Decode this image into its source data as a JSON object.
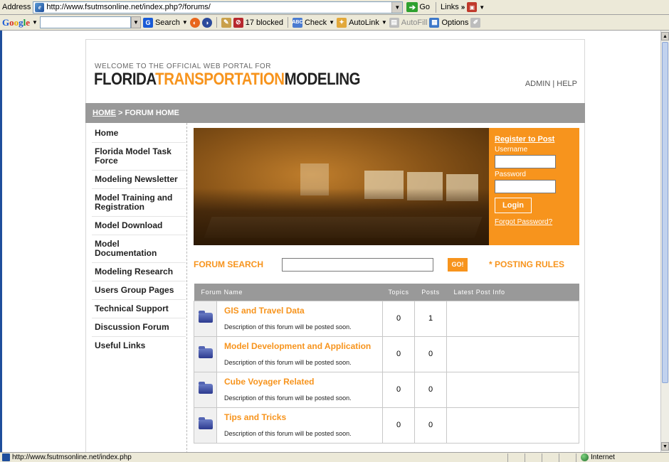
{
  "browser": {
    "address_label": "Address",
    "url": "http://www.fsutmsonline.net/index.php?/forums/",
    "go_label": "Go",
    "links_label": "Links",
    "links_chevron": "»",
    "toolbar": {
      "google_logo": [
        "G",
        "o",
        "o",
        "g",
        "l",
        "e"
      ],
      "search_label": "Search",
      "blocked_label": "17 blocked",
      "check_label": "Check",
      "autolink_label": "AutoLink",
      "autofill_label": "AutoFill",
      "options_label": "Options"
    },
    "status_url": "http://www.fsutmsonline.net/index.php",
    "zone_label": "Internet"
  },
  "header": {
    "welcome": "WELCOME TO THE OFFICIAL WEB PORTAL FOR",
    "brand_part1": "FLORIDA",
    "brand_part2": "TRANSPORTATION",
    "brand_part3": "MODELING",
    "admin_help": "ADMIN | HELP"
  },
  "breadcrumb": {
    "home": "HOME",
    "separator": ">",
    "current": "FORUM HOME"
  },
  "sidebar": {
    "items": [
      "Home",
      "Florida Model Task Force",
      "Modeling Newsletter",
      "Model Training and Registration",
      "Model Download",
      "Model Documentation",
      "Modeling Research",
      "Users Group Pages",
      "Technical Support",
      "Discussion Forum",
      "Useful Links"
    ]
  },
  "login": {
    "register": "Register to Post",
    "username_label": "Username",
    "password_label": "Password",
    "login_button": "Login",
    "forgot": "Forgot Password?"
  },
  "search": {
    "label": "FORUM SEARCH",
    "go": "GO!",
    "rules": "* POSTING RULES"
  },
  "forum_table": {
    "columns": [
      "Forum Name",
      "Topics",
      "Posts",
      "Latest Post Info"
    ],
    "rows": [
      {
        "name": "GIS and Travel Data",
        "description": "Description of this forum will be posted soon.",
        "topics": "0",
        "posts": "1"
      },
      {
        "name": "Model Development and Application",
        "description": "Description of this forum will be posted soon.",
        "topics": "0",
        "posts": "0"
      },
      {
        "name": "Cube Voyager Related",
        "description": "Description of this forum will be posted soon.",
        "topics": "0",
        "posts": "0"
      },
      {
        "name": "Tips and Tricks",
        "description": "Description of this forum will be posted soon.",
        "topics": "0",
        "posts": "0"
      }
    ]
  },
  "colors": {
    "accent": "#f7941d",
    "bar_gray": "#999999",
    "folder_blue": "#2c3a8f"
  }
}
